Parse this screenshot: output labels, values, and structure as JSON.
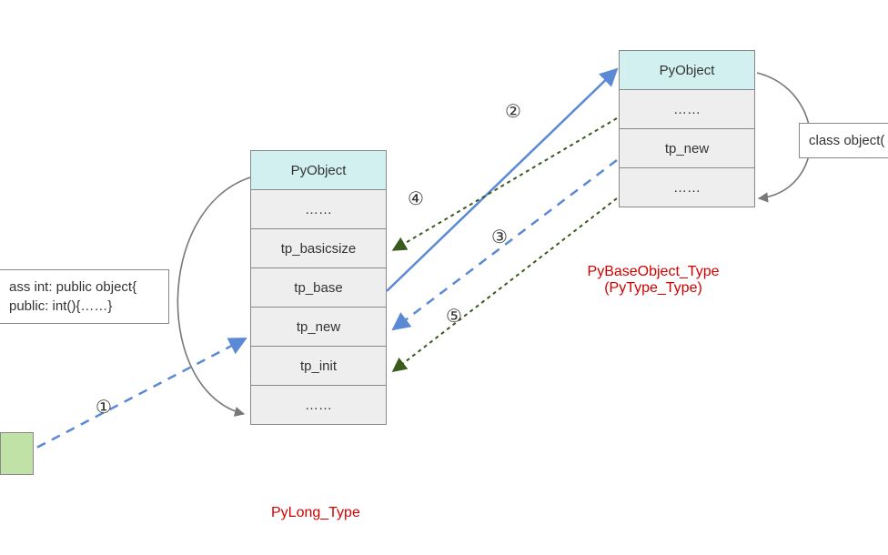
{
  "left_struct": {
    "header": "PyObject",
    "rows": [
      "……",
      "tp_basicsize",
      "tp_base",
      "tp_new",
      "tp_init",
      "……"
    ],
    "caption": "PyLong_Type"
  },
  "right_struct": {
    "header": "PyObject",
    "rows": [
      "……",
      "tp_new",
      "……"
    ],
    "caption_line1": "PyBaseObject_Type",
    "caption_line2": "(PyType_Type)"
  },
  "left_note": {
    "line1": "ass int: public object{",
    "line2": "public: int(){……}"
  },
  "right_note": "class object(",
  "step_labels": {
    "n1": "①",
    "n2": "②",
    "n3": "③",
    "n4": "④",
    "n5": "⑤"
  }
}
